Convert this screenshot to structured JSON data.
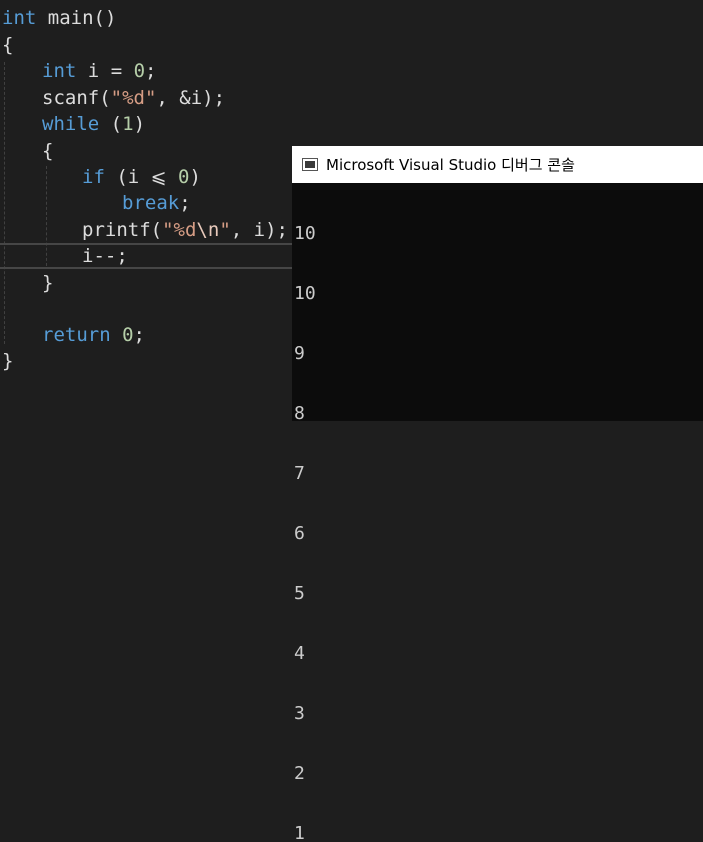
{
  "code": {
    "l1_type": "int",
    "l1_name": "main()",
    "l2": "{",
    "l3_type": "int",
    "l3_var": "i",
    "l3_eq": "=",
    "l3_num": "0",
    "l3_semi": ";",
    "l4_fn": "scanf",
    "l4_open": "(",
    "l4_str": "\"%d\"",
    "l4_rest": ", &i);",
    "l5_kw": "while",
    "l5_open": "(",
    "l5_num": "1",
    "l5_close": ")",
    "l6": "{",
    "l7_kw": "if",
    "l7_cond": "(i ⩽ ",
    "l7_num": "0",
    "l7_close": ")",
    "l8_kw": "break",
    "l8_semi": ";",
    "l9_fn": "printf",
    "l9_open": "(",
    "l9_str1": "\"%d",
    "l9_esc": "\\n",
    "l9_str2": "\"",
    "l9_rest": ", i);",
    "l10": "i--;",
    "l11": "}",
    "l13_kw": "return",
    "l13_num": "0",
    "l13_semi": ";",
    "l14": "}"
  },
  "console": {
    "title": "Microsoft Visual Studio 디버그 콘솔",
    "output": [
      "10",
      "10",
      "9",
      "8",
      "7",
      "6",
      "5",
      "4",
      "3",
      "2",
      "1"
    ]
  },
  "colors": {
    "background": "#1e1e1e",
    "keyword": "#569cd6",
    "string": "#d69d85",
    "number": "#b5cea8",
    "function": "#dcdcaa"
  }
}
